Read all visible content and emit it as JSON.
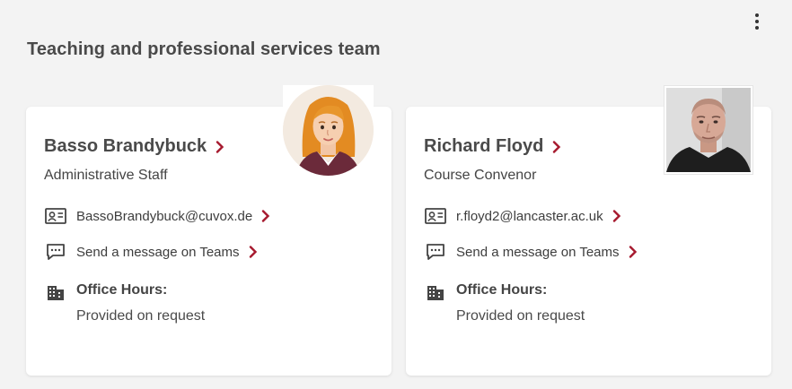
{
  "section": {
    "title": "Teaching and professional services team"
  },
  "colors": {
    "accent": "#a6192e",
    "text": "#3a3a3a",
    "background": "#f3f3f3"
  },
  "people": [
    {
      "name": "Basso Brandybuck",
      "role": "Administrative Staff",
      "email": "BassoBrandybuck@cuvox.de",
      "teams_label": "Send a message on Teams",
      "office_hours_title": "Office Hours:",
      "office_hours_value": "Provided on request",
      "avatar": "illustrated-avatar"
    },
    {
      "name": "Richard Floyd",
      "role": "Course Convenor",
      "email": "r.floyd2@lancaster.ac.uk",
      "teams_label": "Send a message on Teams",
      "office_hours_title": "Office Hours:",
      "office_hours_value": "Provided on request",
      "avatar": "profile-photo"
    }
  ],
  "icons": {
    "menu": "more-vertical-icon",
    "email": "contact-card-icon",
    "teams": "chat-bubble-icon",
    "office": "building-icon",
    "link": "chevron-right-icon"
  }
}
